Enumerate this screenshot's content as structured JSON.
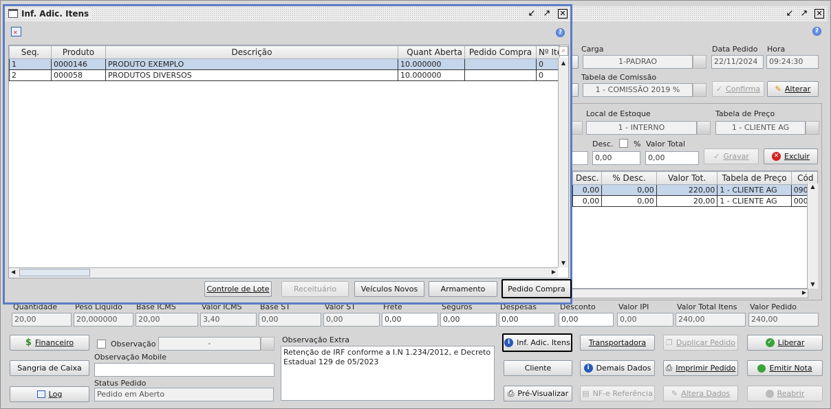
{
  "main_window": {
    "carga_label": "Carga",
    "carga_value": "1-PADRAO",
    "data_pedido_label": "Data Pedido",
    "data_pedido_value": "22/11/2024",
    "hora_label": "Hora",
    "hora_value": "09:24:30",
    "tabela_comissao_label": "Tabela de Comissão",
    "tabela_comissao_value": "1 - COMISSÃO 2019 %",
    "confirma_label": "Confirma",
    "alterar_label": "Alterar",
    "local_estoque_label": "Local de Estoque",
    "local_estoque_value": "1 - INTERNO",
    "tabela_preco_label": "Tabela de Preço",
    "tabela_preco_value": "1 - CLIENTE AG",
    "desc_label": "Desc.",
    "percent_label": "%",
    "valor_total_label": "Valor Total",
    "desc_value": "0,00",
    "valor_total_value": "0,00",
    "gravar_label": "Gravar",
    "excluir_label": "Excluir",
    "items_grid": {
      "headers": [
        "Desc.",
        "% Desc.",
        "Valor Tot.",
        "Tabela de Preço",
        "Cód"
      ],
      "rows": [
        [
          "0,00",
          "0,00",
          "220,00",
          "1 - CLIENTE AG",
          "090"
        ],
        [
          "0,00",
          "0,00",
          "20,00",
          "1 - CLIENTE AG",
          "000"
        ]
      ]
    },
    "totals": {
      "labels": [
        "Quantidade",
        "Peso Líquido",
        "Base ICMS",
        "Valor ICMS",
        "Base ST",
        "Valor ST",
        "Frete",
        "Seguros",
        "Despesas",
        "Desconto",
        "Valor IPI",
        "Valor Total Itens",
        "Valor Pedido"
      ],
      "values": [
        "20,00",
        "20,000000",
        "20,00",
        "3,40",
        "0,00",
        "0,00",
        "0,00",
        "0,00",
        "0,00",
        "0,00",
        "0,00",
        "240,00",
        "240,00"
      ]
    },
    "financeiro_label": "Financeiro",
    "sangria_label": "Sangria de Caixa",
    "log_label": "Log",
    "observacao_label": "Observação",
    "observacao_value": "-",
    "observacao_mobile_label": "Observação Mobile",
    "status_pedido_label": "Status Pedido",
    "status_pedido_value": "Pedido em Aberto",
    "observacao_extra_label": "Observação Extra",
    "observacao_extra_value": "Retenção de IRF conforme a I.N 1.234/2012, e Decreto Estadual 129 de 05/2023",
    "inf_adic_itens_label": "Inf. Adic. Itens",
    "transportadora_label": "Transportadora",
    "duplicar_pedido_label": "Duplicar Pedido",
    "liberar_label": "Liberar",
    "cliente_label": "Cliente",
    "demais_dados_label": "Demais Dados",
    "imprimir_pedido_label": "Imprimir Pedido",
    "emitir_nota_label": "Emitir Nota",
    "pre_visualizar_label": "Pré-Visualizar",
    "nfe_referencia_label": "NF-e Referência",
    "altera_dados_label": "Altera Dados",
    "reabrir_label": "Reabrir"
  },
  "dialog": {
    "title": "Inf. Adic. Itens",
    "grid": {
      "headers": [
        "Seq.",
        "Produto",
        "Descrição",
        "Quant Aberta",
        "Pedido Compra",
        "Nº Ite"
      ],
      "rows": [
        [
          "1",
          "0000146",
          "PRODUTO EXEMPLO",
          "10.000000",
          "",
          "0"
        ],
        [
          "2",
          "000058",
          "PRODUTOS DIVERSOS",
          "10.000000",
          "",
          "0"
        ]
      ]
    },
    "controle_lote_label": "Controle de Lote",
    "receituario_label": "Receituário",
    "veiculos_novos_label": "Veículos Novos",
    "armamento_label": "Armamento",
    "pedido_compra_label": "Pedido Compra"
  },
  "colors": {
    "dialog_border": "#5b7bc6",
    "selected_row": "#c5d5ea",
    "help_icon": "#2958b8",
    "excluir_icon": "#d32020",
    "liberar_icon": "#3aa23a"
  }
}
